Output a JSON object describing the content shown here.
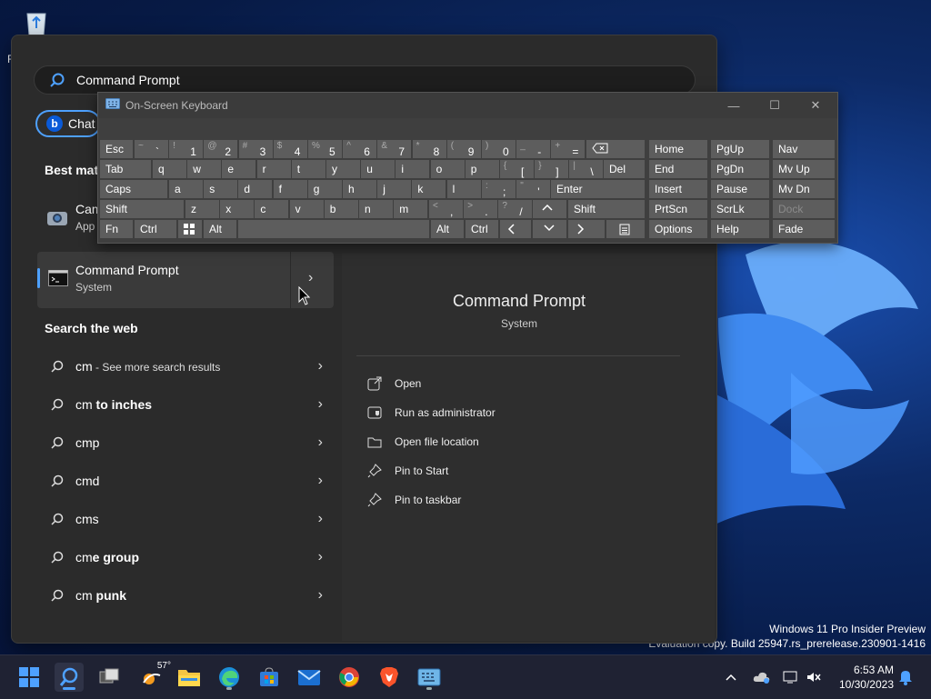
{
  "desktop": {
    "partial_label": "F",
    "watermark_line1": "Windows 11 Pro Insider Preview",
    "watermark_line2": "Evaluation copy. Build 25947.rs_prerelease.230901-1416"
  },
  "search": {
    "query": "Command Prompt",
    "chat_label": "Chat",
    "best_match_title": "Best matc",
    "camera": {
      "title": "Cam",
      "subtitle": "App"
    },
    "best": {
      "title": "Command Prompt",
      "subtitle": "System"
    },
    "web_title": "Search the web",
    "web_items": [
      {
        "prefix": "cm",
        "bold": "",
        "suffix": " - See more search results"
      },
      {
        "prefix": "cm",
        "bold": " to inches",
        "suffix": ""
      },
      {
        "prefix": "cmp",
        "bold": "",
        "suffix": ""
      },
      {
        "prefix": "cmd",
        "bold": "",
        "suffix": ""
      },
      {
        "prefix": "cms",
        "bold": "",
        "suffix": ""
      },
      {
        "prefix": "cm",
        "bold": "e group",
        "suffix": ""
      },
      {
        "prefix": "cm",
        "bold": " punk",
        "suffix": ""
      }
    ]
  },
  "detail": {
    "title": "Command Prompt",
    "subtitle": "System",
    "actions": [
      "Open",
      "Run as administrator",
      "Open file location",
      "Pin to Start",
      "Pin to taskbar"
    ]
  },
  "osk": {
    "title": "On-Screen Keyboard",
    "row1": {
      "esc": "Esc",
      "nums": [
        {
          "s": "~",
          "m": "`"
        },
        {
          "s": "!",
          "m": "1"
        },
        {
          "s": "@",
          "m": "2"
        },
        {
          "s": "#",
          "m": "3"
        },
        {
          "s": "$",
          "m": "4"
        },
        {
          "s": "%",
          "m": "5"
        },
        {
          "s": "^",
          "m": "6"
        },
        {
          "s": "&",
          "m": "7"
        },
        {
          "s": "*",
          "m": "8"
        },
        {
          "s": "(",
          "m": "9"
        },
        {
          "s": ")",
          "m": "0"
        },
        {
          "s": "_",
          "m": "-"
        },
        {
          "s": "+",
          "m": "="
        }
      ]
    },
    "row2": {
      "tab": "Tab",
      "letters": [
        "q",
        "w",
        "e",
        "r",
        "t",
        "y",
        "u",
        "i",
        "o",
        "p"
      ],
      "sym": [
        {
          "s": "{",
          "m": "["
        },
        {
          "s": "}",
          "m": "]"
        },
        {
          "s": "|",
          "m": "\\"
        }
      ],
      "del": "Del"
    },
    "row3": {
      "caps": "Caps",
      "letters": [
        "a",
        "s",
        "d",
        "f",
        "g",
        "h",
        "j",
        "k",
        "l"
      ],
      "sym": [
        {
          "s": ":",
          "m": ";"
        },
        {
          "s": "\"",
          "m": "'"
        }
      ],
      "enter": "Enter"
    },
    "row4": {
      "shift": "Shift",
      "letters": [
        "z",
        "x",
        "c",
        "v",
        "b",
        "n",
        "m"
      ],
      "sym": [
        {
          "s": "<",
          "m": ","
        },
        {
          "s": ">",
          "m": "."
        },
        {
          "s": "?",
          "m": "/"
        }
      ],
      "rshift": "Shift"
    },
    "row5": {
      "fn": "Fn",
      "ctrl": "Ctrl",
      "alt": "Alt",
      "ralt": "Alt",
      "rctrl": "Ctrl"
    },
    "nav": [
      [
        "Home",
        "PgUp",
        "Nav"
      ],
      [
        "End",
        "PgDn",
        "Mv Up"
      ],
      [
        "Insert",
        "Pause",
        "Mv Dn"
      ],
      [
        "PrtScn",
        "ScrLk",
        "Dock"
      ],
      [
        "Options",
        "Help",
        "Fade"
      ]
    ]
  },
  "taskbar": {
    "weather": "57°",
    "time": "6:53 AM",
    "date": "10/30/2023"
  }
}
